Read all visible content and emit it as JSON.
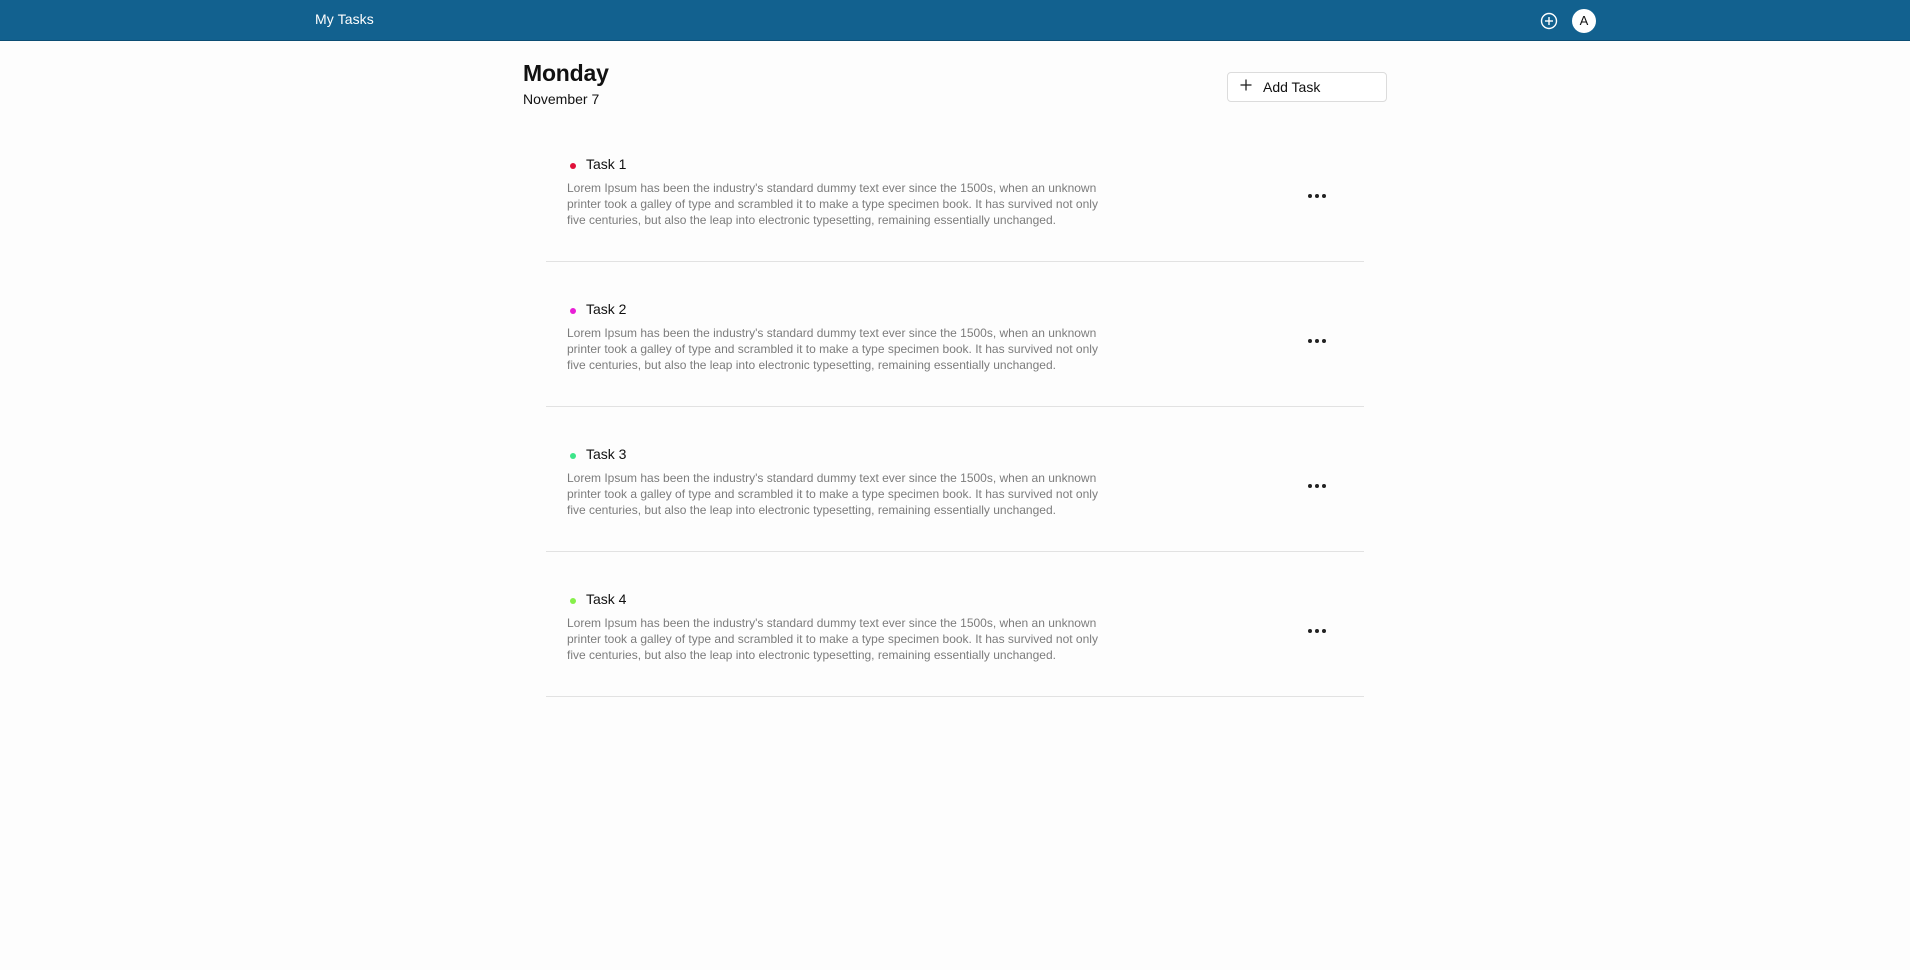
{
  "header": {
    "title": "My Tasks",
    "avatar_initial": "A",
    "plus_icon": "plus-circle-icon",
    "colors": {
      "bar": "#12618f",
      "text": "#ffffff"
    }
  },
  "day": {
    "name": "Monday",
    "date": "November 7"
  },
  "add_task": {
    "label": "Add Task",
    "icon": "plus-icon"
  },
  "tasks": [
    {
      "title": "Task 1",
      "color": "#e0113a",
      "description": "Lorem Ipsum has been the industry's standard dummy text ever since the 1500s, when an unknown printer took a galley of type and scrambled it to make a type specimen book. It has survived not only five centuries, but also the leap into electronic typesetting, remaining essentially unchanged."
    },
    {
      "title": "Task 2",
      "color": "#e81fd6",
      "description": "Lorem Ipsum has been the industry's standard dummy text ever since the 1500s, when an unknown printer took a galley of type and scrambled it to make a type specimen book. It has survived not only five centuries, but also the leap into electronic typesetting, remaining essentially unchanged."
    },
    {
      "title": "Task 3",
      "color": "#3de58a",
      "description": "Lorem Ipsum has been the industry's standard dummy text ever since the 1500s, when an unknown printer took a galley of type and scrambled it to make a type specimen book. It has survived not only five centuries, but also the leap into electronic typesetting, remaining essentially unchanged."
    },
    {
      "title": "Task 4",
      "color": "#86f04a",
      "description": "Lorem Ipsum has been the industry's standard dummy text ever since the 1500s, when an unknown printer took a galley of type and scrambled it to make a type specimen book. It has survived not only five centuries, but also the leap into electronic typesetting, remaining essentially unchanged."
    }
  ]
}
